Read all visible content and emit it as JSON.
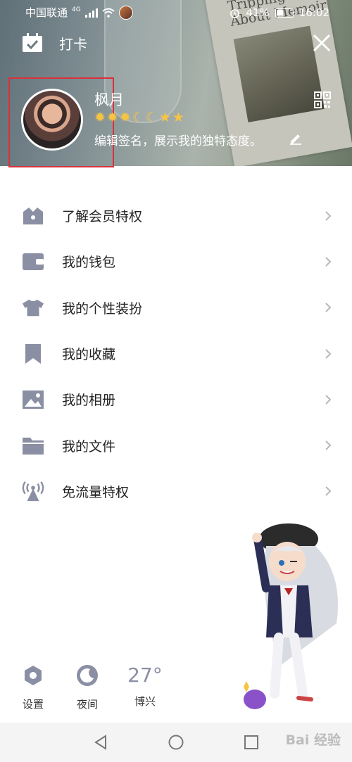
{
  "status_bar": {
    "carrier": "中国联通",
    "network": "4G",
    "battery": "41%",
    "time": "16:02"
  },
  "header": {
    "checkin_label": "打卡",
    "book_title": "Tripping About Memoir"
  },
  "profile": {
    "nickname": "枫月",
    "signature": "编辑签名，展示我的独特态度。",
    "level_icons": [
      "sun",
      "sun",
      "sun",
      "moon",
      "moon",
      "star",
      "star"
    ]
  },
  "menu": [
    {
      "label": "了解会员特权",
      "icon": "crown-icon"
    },
    {
      "label": "我的钱包",
      "icon": "wallet-icon"
    },
    {
      "label": "我的个性装扮",
      "icon": "shirt-icon"
    },
    {
      "label": "我的收藏",
      "icon": "bookmark-icon"
    },
    {
      "label": "我的相册",
      "icon": "photo-icon"
    },
    {
      "label": "我的文件",
      "icon": "folder-icon"
    },
    {
      "label": "免流量特权",
      "icon": "signal-tower-icon"
    }
  ],
  "quick_actions": {
    "settings_label": "设置",
    "night_label": "夜间",
    "temperature": "27°",
    "city": "博兴"
  },
  "watermark": "Bai 经验",
  "colors": {
    "icon_gray": "#8b8fa3",
    "highlight_red": "#d9313a",
    "chevron": "#b8b8b8"
  }
}
